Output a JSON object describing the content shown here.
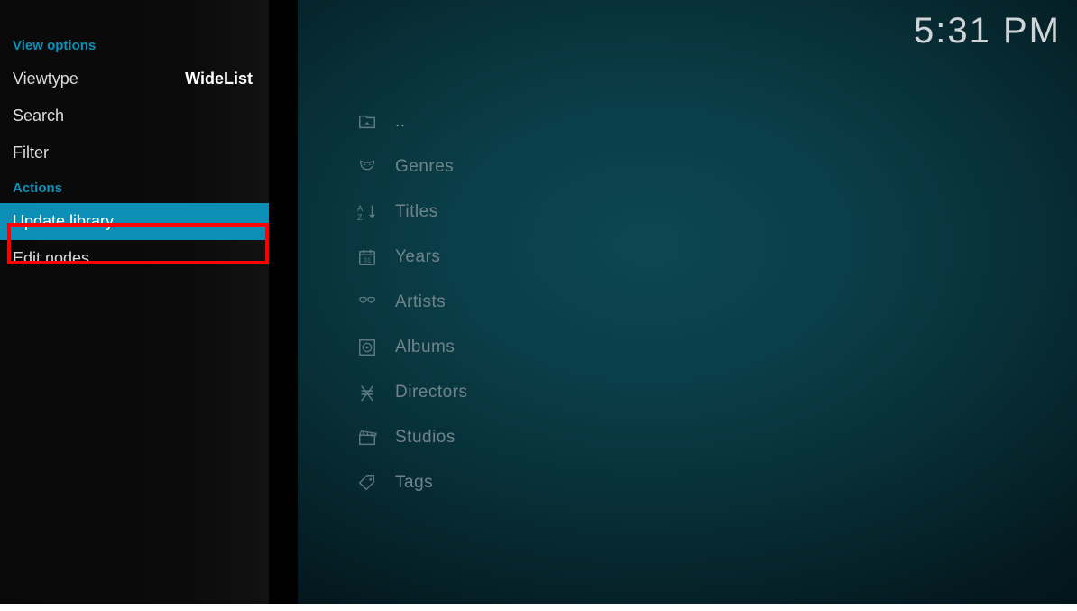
{
  "clock": "5:31 PM",
  "sidebar": {
    "view_options_header": "View options",
    "viewtype_label": "Viewtype",
    "viewtype_value": "WideList",
    "search_label": "Search",
    "filter_label": "Filter",
    "actions_header": "Actions",
    "update_library_label": "Update library",
    "edit_nodes_label": "Edit nodes"
  },
  "main_list": {
    "items": [
      {
        "icon": "folder-up",
        "label": ".."
      },
      {
        "icon": "masks",
        "label": "Genres"
      },
      {
        "icon": "sort-az",
        "label": "Titles"
      },
      {
        "icon": "calendar",
        "label": "Years"
      },
      {
        "icon": "mask",
        "label": "Artists"
      },
      {
        "icon": "disc",
        "label": "Albums"
      },
      {
        "icon": "chair",
        "label": "Directors"
      },
      {
        "icon": "clapper",
        "label": "Studios"
      },
      {
        "icon": "tag",
        "label": "Tags"
      }
    ]
  }
}
